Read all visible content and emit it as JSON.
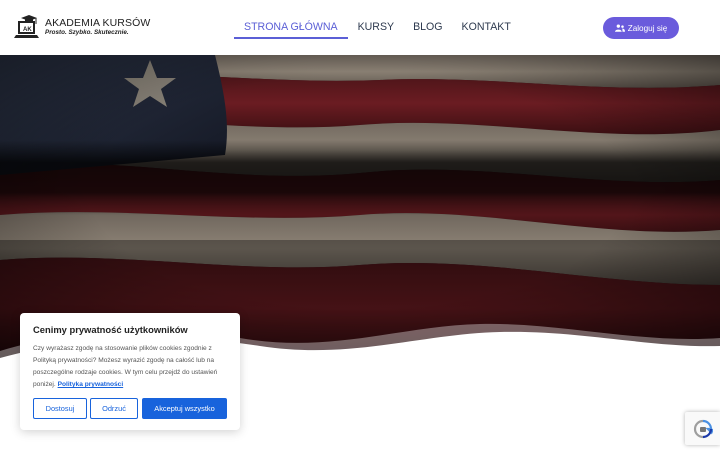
{
  "logo": {
    "title": "AKADEMIA KURSÓW",
    "tagline": "Prosto. Szybko. Skutecznie.",
    "icon": "laptop-graduation-cap-icon"
  },
  "nav": {
    "items": [
      {
        "label": "STRONA GŁÓWNA",
        "active": true
      },
      {
        "label": "KURSY",
        "active": false
      },
      {
        "label": "BLOG",
        "active": false
      },
      {
        "label": "KONTAKT",
        "active": false
      }
    ],
    "login_label": "Zaloguj się",
    "login_icon": "users-icon"
  },
  "hero": {
    "image": "american-flag-photo"
  },
  "cookie": {
    "title": "Cenimy prywatność użytkowników",
    "text": "Czy wyrażasz zgodę na stosowanie plików cookies zgodnie z Polityką prywatności? Możesz wyrazić zgodę na całość lub na poszczególne rodzaje cookies. W tym celu przejdź do ustawień poniżej.",
    "link": "Polityka prywatności",
    "buttons": {
      "customize": "Dostosuj",
      "reject": "Odrzuć",
      "accept": "Akceptuj wszystko"
    }
  },
  "recaptcha": {
    "icon": "recaptcha-icon"
  },
  "colors": {
    "accent": "#5b5fd6",
    "login": "#6a5bdc",
    "cookie_blue": "#1863dc"
  }
}
